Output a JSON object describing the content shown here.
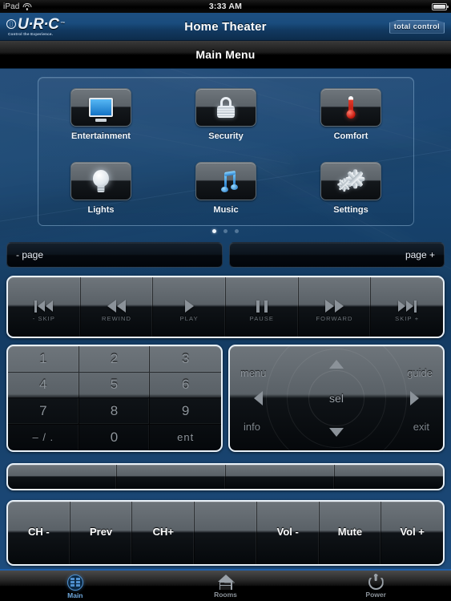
{
  "status_bar": {
    "carrier": "iPad",
    "wifi_icon": "wifi-icon",
    "time": "3:33 AM",
    "battery_icon": "battery-full-icon"
  },
  "header": {
    "logo_text": "U·R·C",
    "logo_tm": "™",
    "logo_tagline": "Control the Experience.",
    "title": "Home Theater",
    "brand_badge": "total control"
  },
  "subheader": {
    "title": "Main Menu"
  },
  "menu": {
    "items": [
      {
        "label": "Entertainment",
        "icon": "television-icon"
      },
      {
        "label": "Security",
        "icon": "padlock-icon"
      },
      {
        "label": "Comfort",
        "icon": "thermometer-icon"
      },
      {
        "label": "Lights",
        "icon": "lightbulb-icon"
      },
      {
        "label": "Music",
        "icon": "music-notes-icon"
      },
      {
        "label": "Settings",
        "icon": "gears-icon"
      }
    ],
    "page_dots": {
      "total": 3,
      "active_index": 0
    }
  },
  "pager": {
    "prev_label": "- page",
    "next_label": "page +"
  },
  "transport": {
    "buttons": [
      {
        "label": "- SKIP",
        "icon": "skip-back-icon"
      },
      {
        "label": "REWIND",
        "icon": "rewind-icon"
      },
      {
        "label": "PLAY",
        "icon": "play-icon"
      },
      {
        "label": "PAUSE",
        "icon": "pause-icon"
      },
      {
        "label": "FORWARD",
        "icon": "fast-forward-icon"
      },
      {
        "label": "SKIP +",
        "icon": "skip-forward-icon"
      }
    ]
  },
  "keypad": {
    "keys": [
      "1",
      "2",
      "3",
      "4",
      "5",
      "6",
      "7",
      "8",
      "9",
      "– / .",
      "0",
      "ent"
    ]
  },
  "dpad": {
    "menu_label": "menu",
    "guide_label": "guide",
    "info_label": "info",
    "exit_label": "exit",
    "select_label": "sel",
    "up_icon": "arrow-up-icon",
    "down_icon": "arrow-down-icon",
    "left_icon": "arrow-left-icon",
    "right_icon": "arrow-right-icon"
  },
  "blank_row": {
    "buttons": [
      "",
      "",
      "",
      ""
    ]
  },
  "chvol": {
    "buttons": [
      "CH -",
      "Prev",
      "CH+",
      "",
      "Vol -",
      "Mute",
      "Vol +"
    ]
  },
  "tabbar": {
    "tabs": [
      {
        "label": "Main",
        "icon": "grid-icon",
        "active": true
      },
      {
        "label": "Rooms",
        "icon": "house-icon",
        "active": false
      },
      {
        "label": "Power",
        "icon": "power-icon",
        "active": false
      }
    ]
  },
  "colors": {
    "accent_blue": "#1f5fa8",
    "body_blue": "#123a61",
    "tab_active": "#4f90cf",
    "comfort_red": "#c4150a"
  }
}
